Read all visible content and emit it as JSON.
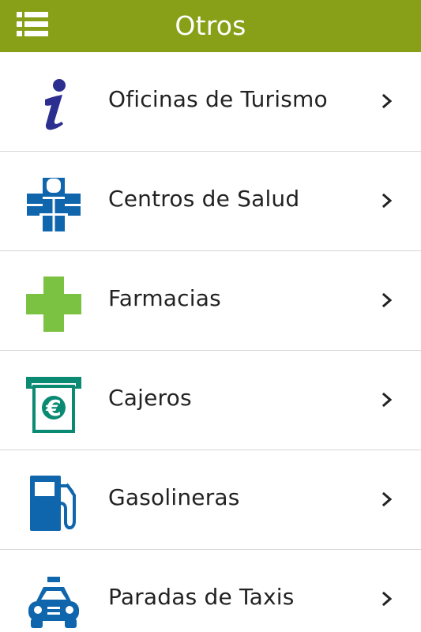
{
  "header": {
    "title": "Otros",
    "menu_icon": "menu-list-icon",
    "background_color": "#87a017"
  },
  "items": [
    {
      "label": "Oficinas de Turismo",
      "icon": "information-icon",
      "icon_color": "#2c2f8f"
    },
    {
      "label": "Centros de Salud",
      "icon": "health-center-cross-icon",
      "icon_color": "#0f66ad"
    },
    {
      "label": "Farmacias",
      "icon": "pharmacy-cross-icon",
      "icon_color": "#7cc242"
    },
    {
      "label": "Cajeros",
      "icon": "atm-euro-icon",
      "icon_color": "#0a8a73"
    },
    {
      "label": "Gasolineras",
      "icon": "fuel-pump-icon",
      "icon_color": "#0f66ad"
    },
    {
      "label": "Paradas de Taxis",
      "icon": "taxi-icon",
      "icon_color": "#0f66ad"
    }
  ],
  "chevron_icon": "chevron-right-icon"
}
